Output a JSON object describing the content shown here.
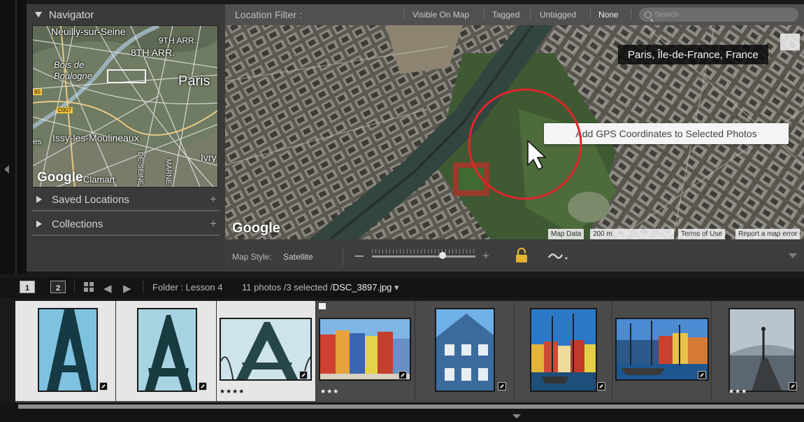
{
  "navigator": {
    "title": "Navigator",
    "map_labels": {
      "neuilly": "Neuilly-sur-Seine",
      "arr9": "9TH ARR.",
      "arr8": "8TH ARR.",
      "bois": "Bois de\nBoulogne",
      "paris": "Paris",
      "issy": "Issy-les-Moulineaux",
      "ivry": "Ivry",
      "road1": "85",
      "road2": "D907",
      "seine": "DE-SEINE",
      "marne": "MARNE",
      "es": "es",
      "clamart": "Clamart",
      "google": "Google"
    }
  },
  "panels": {
    "saved_locations": "Saved Locations",
    "collections": "Collections",
    "add": "+"
  },
  "location_filter": {
    "title": "Location Filter :",
    "options": [
      "Visible On Map",
      "Tagged",
      "Untagged",
      "None"
    ],
    "search_placeholder": "Search"
  },
  "map": {
    "location": "Paris, Île-de-France, France",
    "gps_tooltip": "Add GPS Coordinates to Selected Photos",
    "google": "Google",
    "attribution": {
      "map_data": "Map Data",
      "scale": "200 m",
      "terms": "Terms of Use",
      "report": "Report a map error"
    }
  },
  "map_toolbar": {
    "style_label": "Map Style:",
    "style_value": "Satellite",
    "zoom_level": 0.68
  },
  "filmstrip_header": {
    "screen1": "1",
    "screen2": "2",
    "folder": "Folder : Lesson 4",
    "count": "11 photos /3 selected /",
    "filename": "DSC_3897.jpg"
  },
  "filmstrip": {
    "thumbs": [
      {
        "stars": "",
        "selected": true
      },
      {
        "stars": "",
        "selected": true
      },
      {
        "stars": "★★★★",
        "selected": true
      },
      {
        "stars": "★★★",
        "selected": false
      },
      {
        "stars": "",
        "selected": false
      },
      {
        "stars": "",
        "selected": false
      },
      {
        "stars": "",
        "selected": false
      },
      {
        "stars": "★★★",
        "selected": false
      }
    ]
  },
  "colors": {
    "panel_bg": "#3a3a3a",
    "filter_bar": "#505050",
    "filmstrip_bg": "#4a4a4a",
    "selected_cell": "#e6e6e6",
    "annotation_red": "#e0262c",
    "lock_gold": "#e0b431"
  }
}
